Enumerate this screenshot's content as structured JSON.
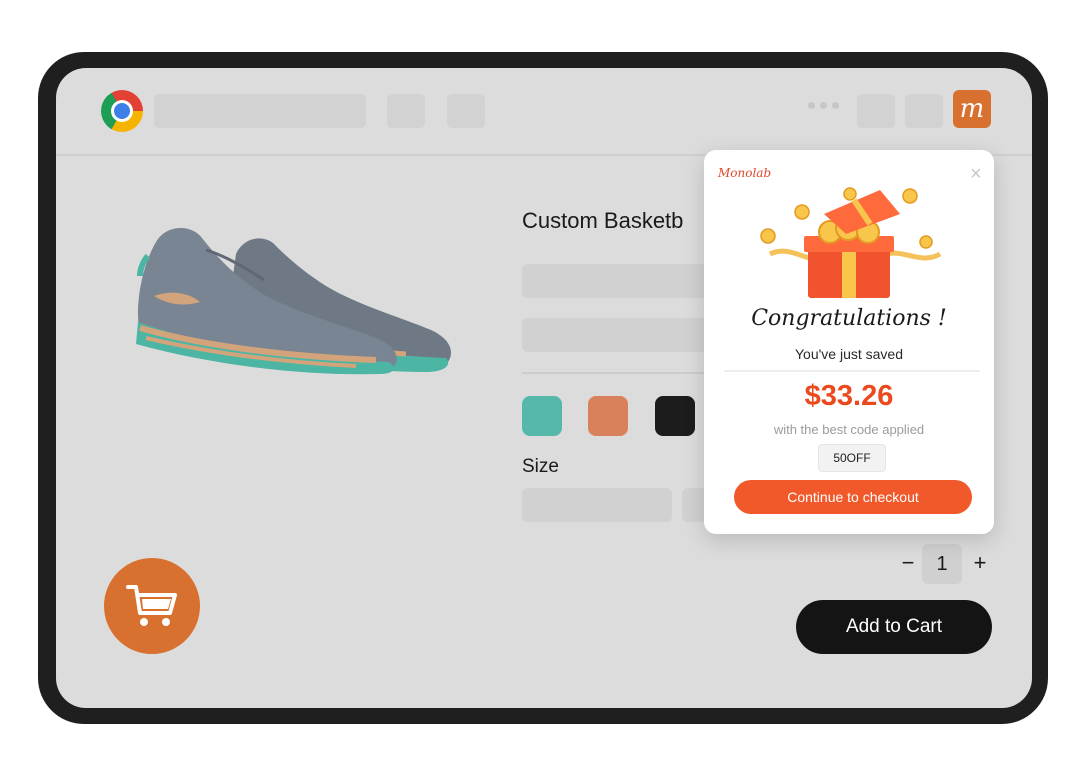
{
  "browser": {
    "extension_letter": "m"
  },
  "product": {
    "title": "Custom Basketb",
    "swatches": [
      {
        "name": "teal",
        "color": "#55b8aa"
      },
      {
        "name": "orange",
        "color": "#d9825a"
      },
      {
        "name": "black",
        "color": "#1c1c1c"
      }
    ],
    "size_label": "Size",
    "quantity": "1",
    "minus_label": "−",
    "plus_label": "+",
    "add_to_cart_label": "Add to Cart"
  },
  "popup": {
    "brand": "Monolab",
    "close_label": "×",
    "heading": "Congratulations !",
    "subtext": "You've just saved",
    "amount": "$33.26",
    "caption": "with the best code applied",
    "code": "50OFF",
    "cta_label": "Continue to checkout"
  },
  "colors": {
    "accent_orange": "#d8702f",
    "popup_red": "#ea4a1d",
    "cta_orange": "#f1592a"
  },
  "icons": [
    "chrome-logo-icon",
    "extension-m-icon",
    "more-dots-icon",
    "close-icon",
    "cart-icon",
    "gift-box-icon"
  ]
}
